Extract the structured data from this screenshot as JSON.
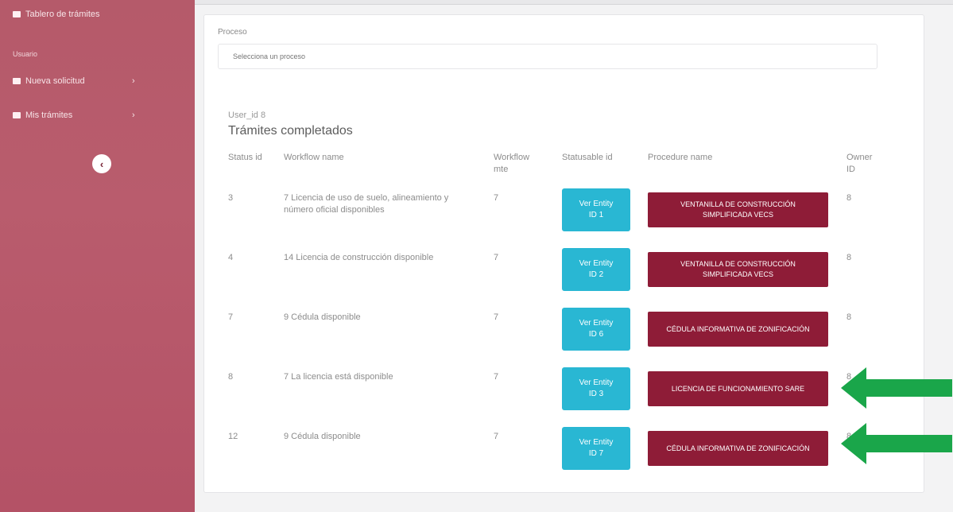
{
  "sidebar": {
    "top_item": "Tablero de trámites",
    "section": "Usuario",
    "items": [
      {
        "label": "Nueva solicitud"
      },
      {
        "label": "Mis trámites"
      }
    ],
    "collapse_glyph": "‹"
  },
  "proceso": {
    "label": "Proceso",
    "placeholder": "Selecciona un proceso"
  },
  "user_id_label": "User_id 8",
  "title": "Trámites completados",
  "table": {
    "headers": [
      "Status id",
      "Workflow name",
      "Workflow mte",
      "Statusable id",
      "Procedure name",
      "Owner ID"
    ],
    "rows": [
      {
        "status_id": "3",
        "workflow_name": "7 Licencia de uso de suelo, alineamiento y número oficial disponibles",
        "workflow_mte": "7",
        "entity_line1": "Ver Entity",
        "entity_line2": "ID 1",
        "procedure_name": "VENTANILLA DE CONSTRUCCIÓN SIMPLIFICADA VECS",
        "owner_id": "8"
      },
      {
        "status_id": "4",
        "workflow_name": "14 Licencia de construcción disponible",
        "workflow_mte": "7",
        "entity_line1": "Ver Entity",
        "entity_line2": "ID 2",
        "procedure_name": "VENTANILLA DE CONSTRUCCIÓN SIMPLIFICADA VECS",
        "owner_id": "8"
      },
      {
        "status_id": "7",
        "workflow_name": "9 Cédula disponible",
        "workflow_mte": "7",
        "entity_line1": "Ver Entity",
        "entity_line2": "ID 6",
        "procedure_name": "CÉDULA INFORMATIVA DE ZONIFICACIÓN",
        "owner_id": "8"
      },
      {
        "status_id": "8",
        "workflow_name": "7 La licencia está disponible",
        "workflow_mte": "7",
        "entity_line1": "Ver Entity",
        "entity_line2": "ID 3",
        "procedure_name": "LICENCIA DE FUNCIONAMIENTO SARE",
        "owner_id": "8"
      },
      {
        "status_id": "12",
        "workflow_name": "9 Cédula disponible",
        "workflow_mte": "7",
        "entity_line1": "Ver Entity",
        "entity_line2": "ID 7",
        "procedure_name": "CÉDULA INFORMATIVA DE ZONIFICACIÓN",
        "owner_id": "8"
      }
    ]
  },
  "colors": {
    "sidebar": "#b55a6a",
    "entity_button": "#29b7d3",
    "procedure_button": "#8e1c37",
    "arrow": "#1aa64a"
  }
}
